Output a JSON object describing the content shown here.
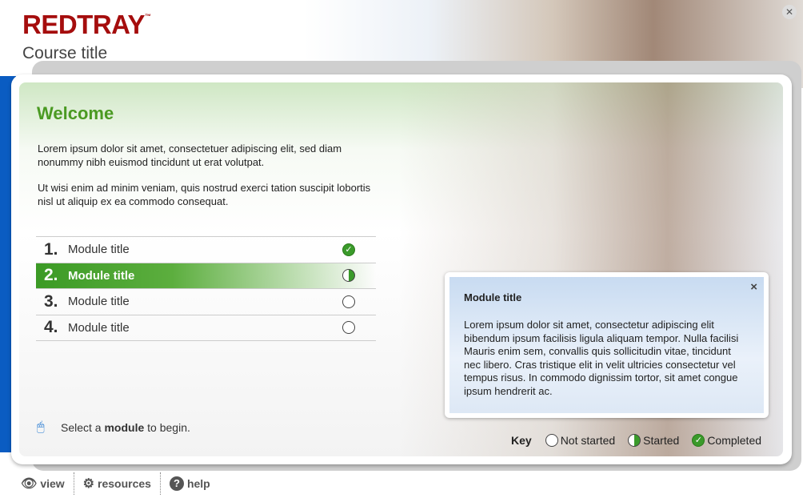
{
  "header": {
    "brand": "REDTRAY",
    "trademark": "™",
    "course_title": "Course title"
  },
  "main": {
    "heading": "Welcome",
    "paragraphs": [
      "Lorem ipsum dolor sit amet, consectetuer adipiscing elit, sed diam nonummy nibh euismod tincidunt ut erat volutpat.",
      "Ut wisi enim ad minim veniam, quis nostrud exerci tation suscipit lobortis nisl ut aliquip ex ea commodo consequat."
    ],
    "modules": [
      {
        "num": "1.",
        "label": "Module title",
        "status": "completed"
      },
      {
        "num": "2.",
        "label": "Module title",
        "status": "started"
      },
      {
        "num": "3.",
        "label": "Module title",
        "status": "not-started"
      },
      {
        "num": "4.",
        "label": "Module title",
        "status": "not-started"
      }
    ],
    "hint": {
      "pre": "Select a ",
      "bold": "module",
      "post": " to begin."
    }
  },
  "popup": {
    "title": "Module title",
    "body": "Lorem ipsum dolor sit amet, consectetur adipiscing elit bibendum ipsum facilisis ligula aliquam tempor. Nulla facilisi Mauris enim sem, convallis quis sollicitudin vitae, tincidunt nec libero. Cras tristique elit in velit ultricies consectetur vel tempus risus. In commodo dignissim tortor, sit amet congue ipsum hendrerit ac.",
    "close": "×"
  },
  "key": {
    "label": "Key",
    "not_started": "Not started",
    "started": "Started",
    "completed": "Completed"
  },
  "footer": {
    "view": "view",
    "resources": "resources",
    "help": "help"
  },
  "colors": {
    "brand": "#a50d0d",
    "accent_green": "#4a9a22",
    "blue_bar": "#0a5cc2"
  }
}
